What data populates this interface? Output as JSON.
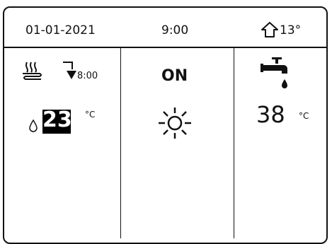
{
  "header": {
    "date": "01-01-2021",
    "time": "9:00",
    "outdoor_temp": "13°",
    "outdoor_icon": "house-icon"
  },
  "heating": {
    "mode_icon": "floor-heating-icon",
    "timer_icon": "timer-icon",
    "timer_time": "8:00",
    "drop_icon": "water-drop-icon",
    "set_temp": "23",
    "unit": "°C"
  },
  "mode": {
    "status": "ON",
    "mode_icon": "sun-icon"
  },
  "hot_water": {
    "icon": "tap-icon",
    "temp": "38",
    "unit": "°C"
  }
}
